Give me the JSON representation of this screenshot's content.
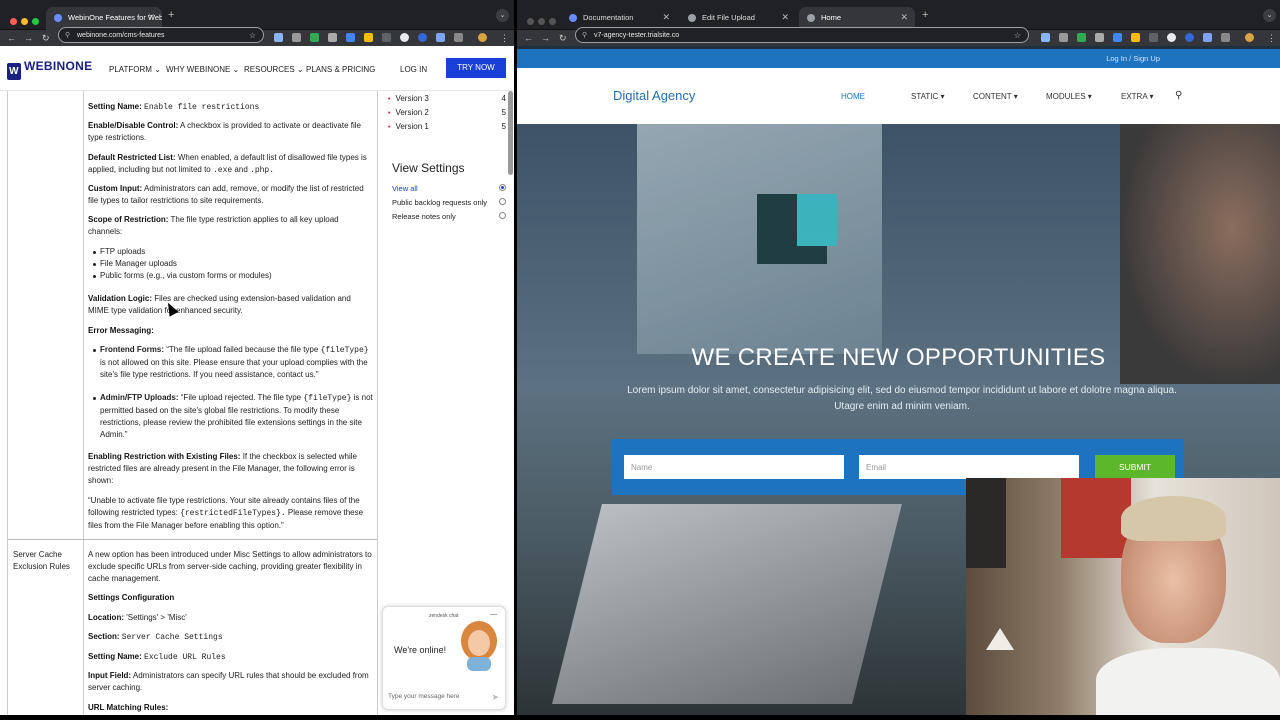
{
  "left_browser": {
    "tab_title": "WebinOne Features for Webi",
    "url": "webinone.com/cms-features"
  },
  "right_browser": {
    "tabs": [
      {
        "title": "Documentation"
      },
      {
        "title": "Edit File Upload"
      },
      {
        "title": "Home"
      }
    ],
    "url": "v7-agency-tester.trialsite.co"
  },
  "webinone": {
    "logo": "WEBINONE",
    "nav": [
      "PLATFORM",
      "WHY WEBINONE",
      "RESOURCES",
      "PLANS & PRICING"
    ],
    "login": "LOG IN",
    "try_now": "TRY NOW"
  },
  "doc": {
    "setting_name_label": "Setting Name:",
    "setting_name_value": "Enable file restrictions",
    "enable_label": "Enable/Disable Control:",
    "enable_text": "A checkbox is provided to activate or deactivate file type restrictions.",
    "default_label": "Default Restricted List:",
    "default_text_a": "When enabled, a default list of disallowed file types is applied, including but not limited to",
    "default_ext1": ".exe",
    "default_and": "and",
    "default_ext2": ".php.",
    "custom_label": "Custom Input:",
    "custom_text": "Administrators can add, remove, or modify the list of restricted file types to tailor restrictions to site requirements.",
    "scope_label": "Scope of Restriction:",
    "scope_text": "The file type restriction applies to all key upload channels:",
    "channels": [
      "FTP uploads",
      "File Manager uploads",
      "Public forms (e.g., via custom forms or modules)"
    ],
    "validation_label": "Validation Logic:",
    "validation_text": "Files are checked using extension-based validation and MIME type validation for enhanced security.",
    "error_label": "Error Messaging:",
    "frontend_label": "Frontend Forms:",
    "frontend_text_a": "“The file upload failed because the file type",
    "frontend_code": "{fileType}",
    "frontend_text_b": "is not allowed on this site. Please ensure that your upload complies with the site's file type restrictions. If you need assistance, contact us.”",
    "admin_label": "Admin/FTP Uploads:",
    "admin_text_a": "“File upload rejected. The file type",
    "admin_code": "{fileType}",
    "admin_text_b": "is not permitted based on the site's global file restrictions. To modify these restrictions, please review the prohibited file extensions settings in the site Admin.”",
    "existing_label": "Enabling Restriction with Existing Files:",
    "existing_text": "If the checkbox is selected while restricted files are already present in the File Manager, the following error is shown:",
    "existing_msg_a": "“Unable to activate file type restrictions. Your site already contains files of the following restricted types:",
    "existing_code": "{restrictedFileTypes}.",
    "existing_msg_b": "Please remove these files from the File Manager before enabling this option.”",
    "row2_name": "Server Cache Exclusion Rules",
    "row2_intro": "A new option has been introduced under Misc Settings to allow administrators to exclude specific URLs from server-side caching, providing greater flexibility in cache management.",
    "settings_config": "Settings Configuration",
    "location_label": "Location:",
    "location_value": "'Settings' > 'Misc'",
    "section_label": "Section:",
    "section_value": "Server Cache Settings",
    "setting2_label": "Setting Name:",
    "setting2_value": "Exclude URL Rules",
    "input_label": "Input Field:",
    "input_text": "Administrators can specify URL rules that should be excluded from server caching.",
    "url_matching": "URL Matching Rules:"
  },
  "sidebar": {
    "versions": [
      {
        "label": "Version 3",
        "count": "4"
      },
      {
        "label": "Version 2",
        "count": "5"
      },
      {
        "label": "Version 1",
        "count": "5"
      }
    ],
    "view_settings": "View Settings",
    "options": [
      "View all",
      "Public backlog requests only",
      "Release notes only"
    ]
  },
  "zendesk": {
    "title": "zendesk chat",
    "online": "We're online!",
    "placeholder": "Type your message here"
  },
  "agency": {
    "login": "Log In / Sign Up",
    "brand": "Digital Agency",
    "nav": [
      "HOME",
      "STATIC",
      "CONTENT",
      "MODULES",
      "EXTRA"
    ],
    "headline": "WE CREATE NEW OPPORTUNITIES",
    "subtext": "Lorem ipsum dolor sit amet, consectetur adipisicing elit, sed do eiusmod tempor incididunt ut labore et dolotre magna aliqua. Utagre enim ad minim veniam.",
    "name_placeholder": "Name",
    "email_placeholder": "Email",
    "submit": "SUBMIT"
  },
  "colors": {
    "webinone_blue": "#1a3fd6",
    "agency_blue": "#1e73be",
    "submit_green": "#5cb82a"
  }
}
